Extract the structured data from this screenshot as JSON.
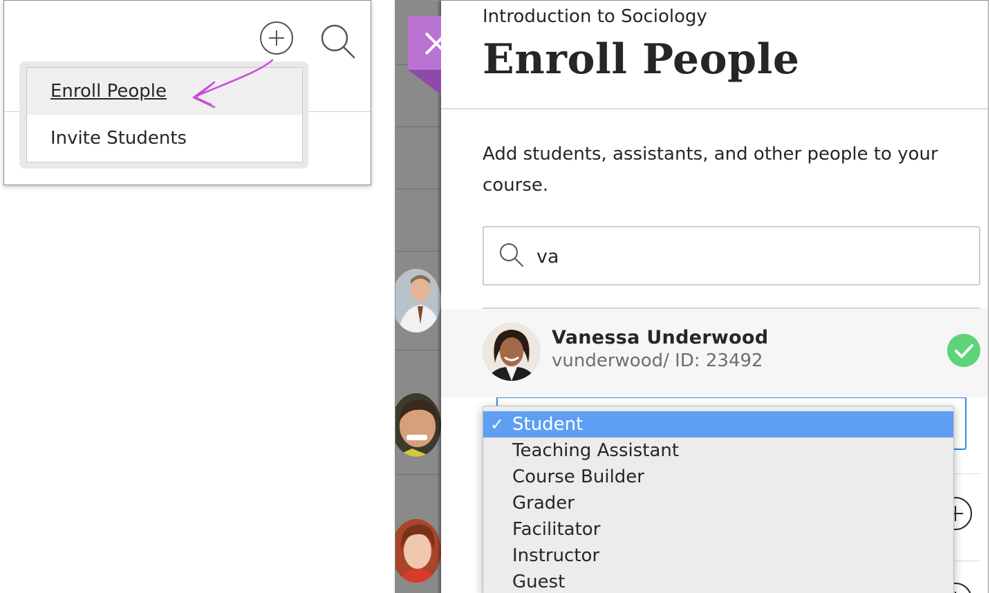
{
  "menu": {
    "items": [
      {
        "label": "Enroll People",
        "active": true
      },
      {
        "label": "Invite Students",
        "active": false
      }
    ],
    "icons": {
      "add": "plus-circle-icon",
      "search": "search-icon",
      "pointer": "hand-drawn-arrow"
    },
    "accent_color": "#c94bd6"
  },
  "panel": {
    "course_name": "Introduction to Sociology",
    "title": "Enroll People",
    "description": "Add students, assistants, and other people to your course.",
    "close_icon": "close-icon",
    "close_color": "#b873d3",
    "search": {
      "value": "va",
      "icon": "search-icon"
    },
    "result": {
      "name": "Vanessa Underwood",
      "username": "vunderwood",
      "id_text": "/ ID: 23492",
      "status_icon": "check-circle-icon",
      "status_color": "#5dd47a"
    },
    "role_options": [
      {
        "label": "Student",
        "selected": true,
        "checkmark": "✓"
      },
      {
        "label": "Teaching Assistant",
        "selected": false
      },
      {
        "label": "Course Builder",
        "selected": false
      },
      {
        "label": "Grader",
        "selected": false
      },
      {
        "label": "Facilitator",
        "selected": false
      },
      {
        "label": "Instructor",
        "selected": false
      },
      {
        "label": "Guest",
        "selected": false
      }
    ],
    "selection_color": "#5f9ff3"
  }
}
